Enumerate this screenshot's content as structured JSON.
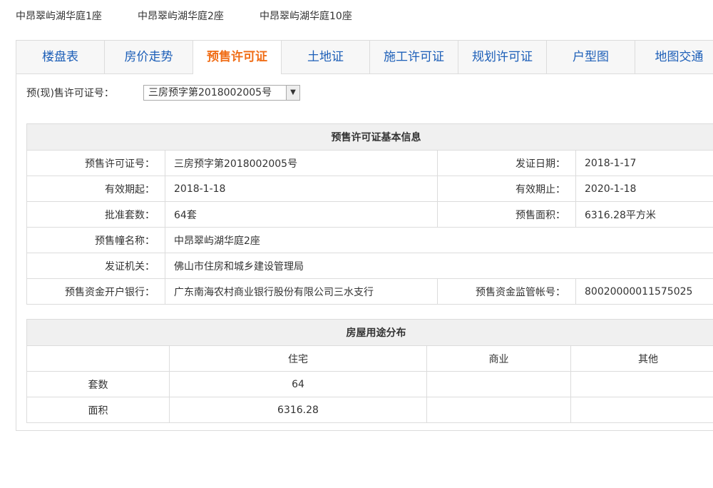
{
  "top_links": [
    "中昂翠屿湖华庭1座",
    "中昂翠屿湖华庭2座",
    "中昂翠屿湖华庭10座"
  ],
  "tabs": [
    "楼盘表",
    "房价走势",
    "预售许可证",
    "土地证",
    "施工许可证",
    "规划许可证",
    "户型图",
    "地图交通"
  ],
  "active_tab": "预售许可证",
  "permit_select": {
    "label": "预(现)售许可证号：",
    "value": "三房预字第2018002005号"
  },
  "basic_info": {
    "title": "预售许可证基本信息",
    "permit_no_label": "预售许可证号：",
    "permit_no": "三房预字第2018002005号",
    "issue_date_label": "发证日期：",
    "issue_date": "2018-1-17",
    "valid_from_label": "有效期起：",
    "valid_from": "2018-1-18",
    "valid_to_label": "有效期止：",
    "valid_to": "2020-1-18",
    "approved_units_label": "批准套数：",
    "approved_units": "64套",
    "presale_area_label": "预售面积：",
    "presale_area": "6316.28平方米",
    "building_label": "预售幢名称：",
    "building": "中昂翠屿湖华庭2座",
    "authority_label": "发证机关：",
    "authority": "佛山市住房和城乡建设管理局",
    "bank_label": "预售资金开户银行：",
    "bank": "广东南海农村商业银行股份有限公司三水支行",
    "account_label": "预售资金监管帐号：",
    "account": "80020000011575025"
  },
  "usage": {
    "title": "房屋用途分布",
    "headers": [
      "",
      "住宅",
      "商业",
      "其他"
    ],
    "rows": [
      {
        "label": "套数",
        "residential": "64",
        "commercial": "",
        "other": ""
      },
      {
        "label": "面积",
        "residential": "6316.28",
        "commercial": "",
        "other": ""
      }
    ]
  }
}
